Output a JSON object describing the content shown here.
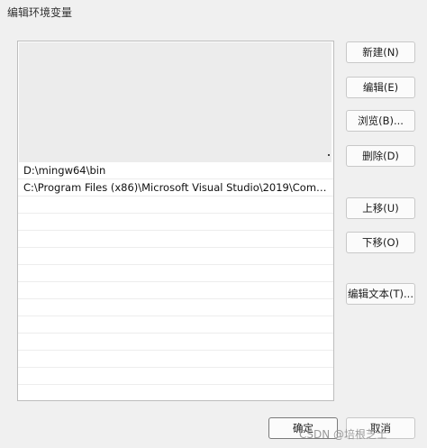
{
  "window": {
    "title": "编辑环境变量"
  },
  "list": {
    "rows": [
      "D:\\mingw64\\bin",
      "C:\\Program Files (x86)\\Microsoft Visual Studio\\2019\\Community..."
    ],
    "empty_row_count": 11
  },
  "buttons": {
    "new": "新建(N)",
    "edit": "编辑(E)",
    "browse": "浏览(B)...",
    "delete": "删除(D)",
    "move_up": "上移(U)",
    "move_down": "下移(O)",
    "edit_text": "编辑文本(T)...",
    "ok": "确定",
    "cancel": "取消"
  },
  "watermark": "CSDN @培根芝士"
}
